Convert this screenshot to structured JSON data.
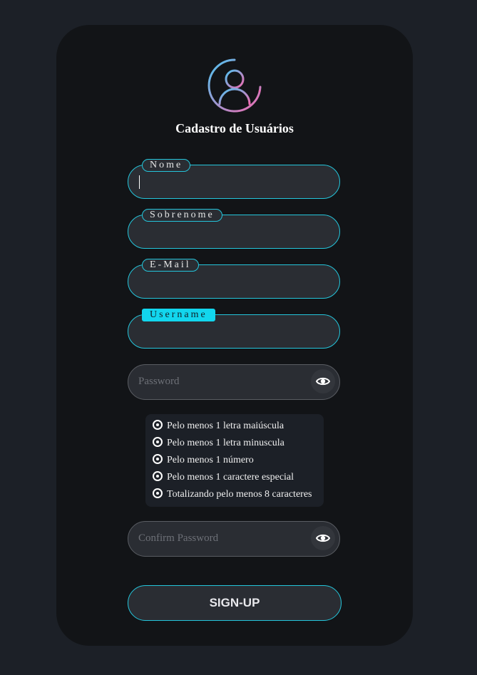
{
  "form": {
    "title": "Cadastro de Usuários",
    "fields": {
      "nome": "Nome",
      "sobrenome": "Sobrenome",
      "email": "E-Mail",
      "username": "Username"
    },
    "password_placeholder": "Password",
    "confirm_password_placeholder": "Confirm Password",
    "password_rules": [
      "Pelo menos 1 letra maiúscula",
      "Pelo menos 1 letra minuscula",
      "Pelo menos 1 número",
      "Pelo menos 1 caractere especial",
      "Totalizando pelo menos 8 caracteres"
    ],
    "submit_label": "SIGN-UP"
  },
  "colors": {
    "page_background": "#1c2027",
    "card_background": "#121417",
    "accent": "#24c6dc",
    "active_label": "#12d6ee",
    "avatar_gradient": [
      "#4ec3f0",
      "#f06ab0"
    ]
  },
  "icons": {
    "avatar": "user-avatar-icon",
    "toggle_password": "eye-icon",
    "rule_bullet": "radio-dot-icon"
  }
}
